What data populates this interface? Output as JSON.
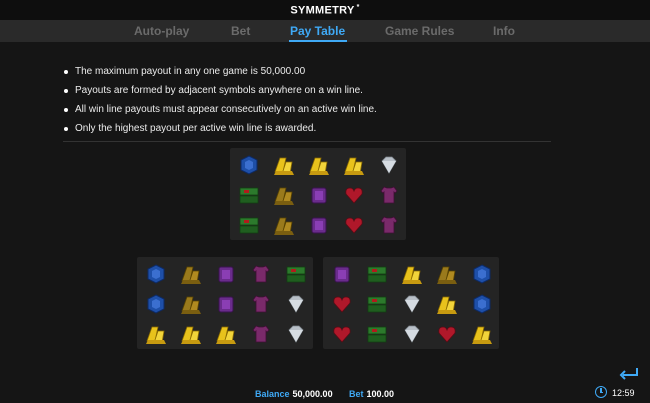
{
  "app": {
    "title": "SYMMETRY",
    "title_mark": "*"
  },
  "tabs": [
    {
      "label": "Auto-play"
    },
    {
      "label": "Bet"
    },
    {
      "label": "Pay Table",
      "active": true
    },
    {
      "label": "Game Rules"
    },
    {
      "label": "Info"
    }
  ],
  "rules": [
    "The maximum payout in any one game is 50,000.00",
    "Payouts are formed by adjacent symbols anywhere on a win line.",
    "All win line payouts must appear consecutively on an active win line.",
    "Only the highest payout per active win line is awarded."
  ],
  "symbol_colors": {
    "gold": "#e8c21c",
    "blue": "#1e4fa8",
    "green": "#2c7a2c",
    "purple": "#6a2c8c",
    "red": "#b0182a",
    "diamond": "#b9c0c8",
    "accent": "#3fa9f5"
  },
  "grids": [
    {
      "rows": [
        [
          "sapphire-icon",
          "gold-bars-icon",
          "gold-bars-icon",
          "gold-bars-icon",
          "diamond-icon"
        ],
        [
          "money-stack-icon",
          "bronze-bars-icon",
          "amethyst-icon",
          "ruby-heart-icon",
          "shirt-icon"
        ],
        [
          "money-stack-icon",
          "bronze-bars-icon",
          "amethyst-icon",
          "ruby-heart-icon",
          "shirt-icon"
        ]
      ]
    },
    {
      "rows": [
        [
          "sapphire-icon",
          "bronze-bars-icon",
          "amethyst-icon",
          "shirt-icon",
          "money-stack-icon"
        ],
        [
          "sapphire-icon",
          "bronze-bars-icon",
          "amethyst-icon",
          "shirt-icon",
          "diamond-icon"
        ],
        [
          "gold-bars-icon",
          "gold-bars-icon",
          "gold-bars-icon",
          "shirt-icon",
          "diamond-icon"
        ]
      ]
    },
    {
      "rows": [
        [
          "amethyst-icon",
          "money-stack-icon",
          "gold-bars-icon",
          "bronze-bars-icon",
          "sapphire-icon"
        ],
        [
          "ruby-heart-icon",
          "money-stack-icon",
          "diamond-icon",
          "gold-bars-icon",
          "sapphire-icon"
        ],
        [
          "ruby-heart-icon",
          "money-stack-icon",
          "diamond-icon",
          "ruby-heart-icon",
          "gold-bars-icon"
        ]
      ]
    }
  ],
  "footer": {
    "balance_label": "Balance",
    "balance_value": "50,000.00",
    "bet_label": "Bet",
    "bet_value": "100.00",
    "clock": "12:59"
  }
}
